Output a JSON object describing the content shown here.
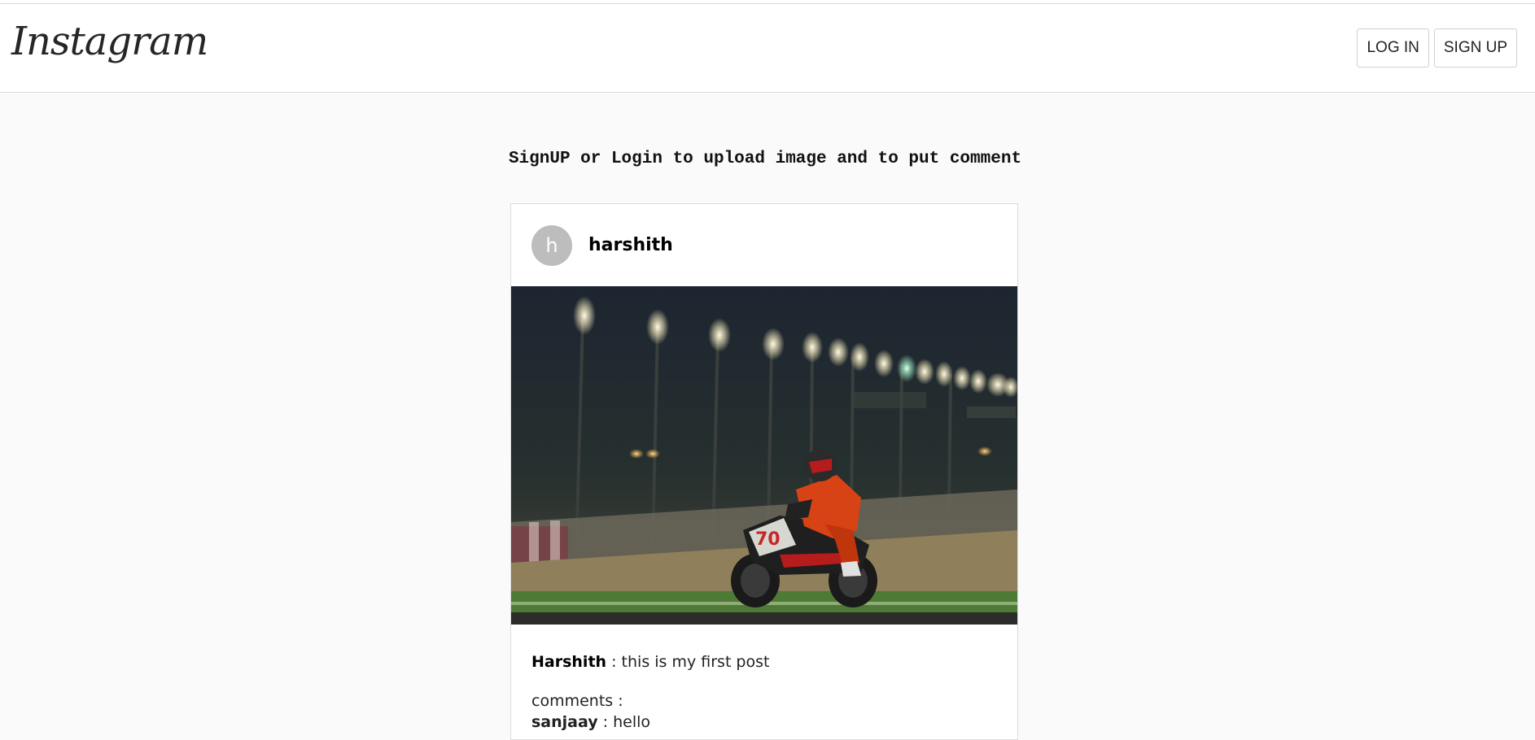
{
  "header": {
    "logo_text": "Instagram",
    "login_label": "LOG IN",
    "signup_label": "SIGN UP"
  },
  "notice": "SignUP or Login to upload image and to put comment",
  "post": {
    "avatar_initial": "h",
    "username": "harshith",
    "image_description": "motorcycle-racer-night-track",
    "caption_user": "Harshith",
    "caption_separator": " : ",
    "caption_text": "this is my first post",
    "comments_label": "comments :",
    "comments": [
      {
        "user": "sanjaay",
        "separator": " : ",
        "text": "hello"
      }
    ]
  },
  "colors": {
    "page_bg": "#fafafa",
    "header_bg": "#ffffff",
    "border": "#dbdbdb",
    "avatar_bg": "#bdbdbd"
  }
}
